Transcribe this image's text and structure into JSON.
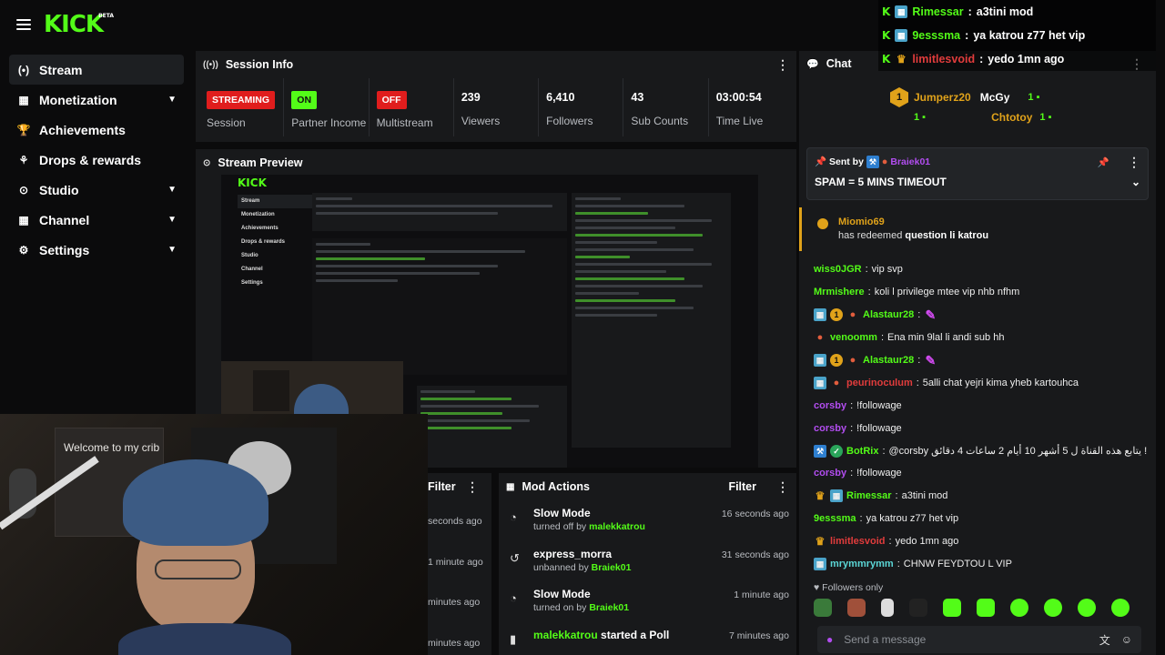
{
  "brand": {
    "name": "KICK",
    "tag": "BETA"
  },
  "nav": [
    {
      "label": "Stream",
      "icon": "(•)",
      "active": true,
      "chevron": false
    },
    {
      "label": "Monetization",
      "icon": "▦",
      "chevron": true
    },
    {
      "label": "Achievements",
      "icon": "🏆",
      "chevron": false
    },
    {
      "label": "Drops & rewards",
      "icon": "⚘",
      "chevron": false
    },
    {
      "label": "Studio",
      "icon": "⊙",
      "chevron": true
    },
    {
      "label": "Channel",
      "icon": "▦",
      "chevron": true
    },
    {
      "label": "Settings",
      "icon": "⚙",
      "chevron": true
    }
  ],
  "session": {
    "title": "Session Info",
    "badges": [
      {
        "value": "STREAMING",
        "label": "Session"
      },
      {
        "value": "ON",
        "label": "Partner Income"
      },
      {
        "value": "OFF",
        "label": "Multistream"
      }
    ],
    "numbers": [
      {
        "value": "239",
        "label": "Viewers"
      },
      {
        "value": "6,410",
        "label": "Followers"
      },
      {
        "value": "43",
        "label": "Sub Counts"
      },
      {
        "value": "03:00:54",
        "label": "Time Live"
      }
    ]
  },
  "preview": {
    "title": "Stream Preview",
    "mini_nav": [
      "Stream",
      "Monetization",
      "Achievements",
      "Drops & rewards",
      "Studio",
      "Channel",
      "Settings"
    ],
    "mini_logo": "KICK",
    "webcam_poster": "Welcome to my crib"
  },
  "filter_col": {
    "label": "Filter",
    "times": [
      "seconds ago",
      "1 minute ago",
      "minutes ago",
      "minutes ago"
    ]
  },
  "mod_actions": {
    "title": "Mod Actions",
    "filter": "Filter",
    "rows": [
      {
        "title": "Slow Mode",
        "sub": "turned off by",
        "user": "malekkatrou",
        "time": "16 seconds ago"
      },
      {
        "title": "express_morra",
        "sub": "unbanned by",
        "user": "Braiek01",
        "time": "31 seconds ago"
      },
      {
        "title": "Slow Mode",
        "sub": "turned on by",
        "user": "Braiek01",
        "time": "1 minute ago"
      },
      {
        "title_user": "malekkatrou",
        "title_rest": " started a Poll",
        "time": "7 minutes ago"
      }
    ]
  },
  "chat": {
    "title": "Chat",
    "gifters": [
      {
        "name": "Jumperz20",
        "count": "1"
      },
      {
        "name": "McGy",
        "count": "1"
      },
      {
        "name": "Chtotoy",
        "count": "1"
      }
    ],
    "gift_rank": "1",
    "pinned": {
      "sent_by": "Sent by",
      "user": "Braiek01",
      "message": "SPAM = 5 MINS TIMEOUT"
    },
    "redeem": {
      "user": "Miomio69",
      "text": "has redeemed",
      "reward": "question li katrou"
    },
    "messages": [
      {
        "user": "wiss0JGR",
        "color": "green",
        "text": "vip svp",
        "badges": []
      },
      {
        "user": "Mrmishere",
        "color": "green",
        "text": "koli l privilege mtee vip nhb nfhm",
        "badges": []
      },
      {
        "user": "Alastaur28",
        "color": "green",
        "text": "",
        "badges": [
          "sub",
          "one",
          "hat"
        ],
        "emote": true
      },
      {
        "user": "venoomm",
        "color": "green",
        "text": "Ena min 9lal li andi sub hh",
        "badges": [
          "hat"
        ]
      },
      {
        "user": "Alastaur28",
        "color": "green",
        "text": "",
        "badges": [
          "sub",
          "one",
          "hat"
        ],
        "emote": true
      },
      {
        "user": "peurinoculum",
        "color": "red",
        "text": "5alli chat yejri kima yheb kartouhca",
        "badges": [
          "sub",
          "hat"
        ]
      },
      {
        "user": "corsby",
        "color": "purple",
        "text": "!followage",
        "badges": []
      },
      {
        "user": "corsby",
        "color": "purple",
        "text": "!followage",
        "badges": []
      },
      {
        "user": "BotRix",
        "color": "green",
        "text": "@corsby يتابع هذه القناة ل 5 أشهر 10 أيام 2 ساعات 4 دقائق !",
        "badges": [
          "bot",
          "ver"
        ]
      },
      {
        "user": "corsby",
        "color": "purple",
        "text": "!followage",
        "badges": []
      },
      {
        "user": "Rimessar",
        "color": "green",
        "text": "a3tini mod",
        "badges": [
          "crown",
          "sub"
        ]
      },
      {
        "user": "9esssma",
        "color": "green",
        "text": "ya katrou z77 het vip",
        "badges": []
      },
      {
        "user": "limitlesvoid",
        "color": "red",
        "text": "yedo 1mn ago",
        "badges": [
          "crown"
        ]
      },
      {
        "user": "mrymmrymm",
        "color": "cyan",
        "text": "CHNW FEYDTOU L VIP",
        "badges": [
          "sub"
        ]
      }
    ],
    "followers_only": "Followers only",
    "input_placeholder": "Send a message"
  },
  "overlay": [
    {
      "user": "Rimessar",
      "color": "#53fc18",
      "text": "a3tini mod"
    },
    {
      "user": "9esssma",
      "color": "#53fc18",
      "text": "ya katrou z77 het vip"
    },
    {
      "user": "limitlesvoid",
      "color": "#e13c3c",
      "text": "yedo 1mn ago"
    }
  ]
}
